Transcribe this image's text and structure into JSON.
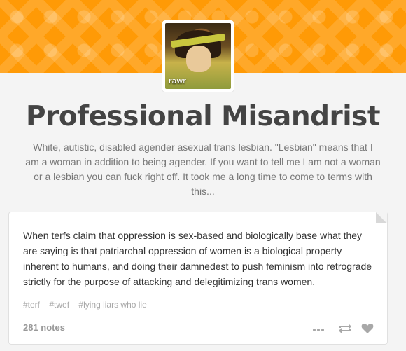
{
  "blog": {
    "title": "Professional Misandrist",
    "description": "White, autistic, disabled agender asexual trans lesbian. \"Lesbian\" means that I am a woman in addition to being agender. If you want to tell me I am not a woman or a lesbian you can fuck right off. It took me a long time to come to terms with this...",
    "avatar_caption": "rawr",
    "accent_color": "#ff9a06"
  },
  "post": {
    "body": "When terfs claim that oppression is sex-based and biologically base what they are saying is that patriarchal oppression of women is a biological property inherent to humans, and doing their damnedest to push feminism into retrograde strictly for the purpose of attacking and delegitimizing trans women.",
    "tags": [
      "#terf",
      "#twef",
      "#lying liars who lie"
    ],
    "notes": "281 notes",
    "icons": [
      "more-icon",
      "reblog-icon",
      "heart-icon"
    ]
  }
}
